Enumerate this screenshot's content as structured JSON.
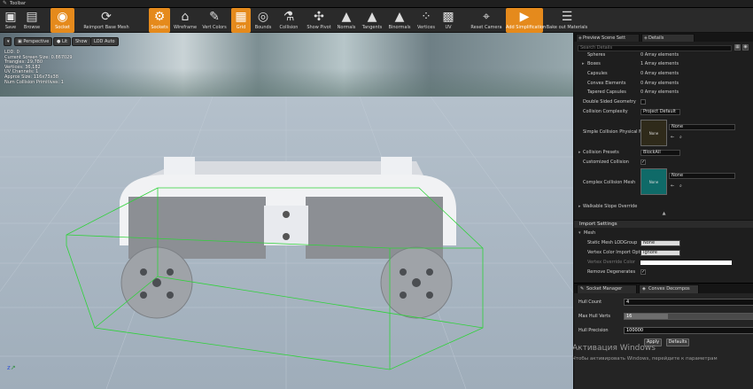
{
  "window": {
    "title": "Toolbar"
  },
  "toolbar": {
    "items": [
      {
        "label": "Save",
        "icon": "save-icon",
        "active": false
      },
      {
        "label": "Browse",
        "icon": "browse-icon",
        "active": false
      },
      {
        "label": "Socket",
        "icon": "socket-icon",
        "active": true
      },
      {
        "label": "Reimport Base Mesh",
        "icon": "reimport-icon",
        "active": false
      },
      {
        "label": "Sockets",
        "icon": "sockets-icon",
        "active": true
      },
      {
        "label": "Wireframe",
        "icon": "wireframe-icon",
        "active": false
      },
      {
        "label": "Vert Colors",
        "icon": "vert-colors-icon",
        "active": false
      },
      {
        "label": "Grid",
        "icon": "grid-icon",
        "active": true
      },
      {
        "label": "Bounds",
        "icon": "bounds-icon",
        "active": false
      },
      {
        "label": "Collision",
        "icon": "collision-icon",
        "active": false
      },
      {
        "label": "Show Pivot",
        "icon": "pivot-icon",
        "active": false
      },
      {
        "label": "Normals",
        "icon": "normals-icon",
        "active": false
      },
      {
        "label": "Tangents",
        "icon": "tangents-icon",
        "active": false
      },
      {
        "label": "Binormals",
        "icon": "binormals-icon",
        "active": false
      },
      {
        "label": "Vertices",
        "icon": "vertices-icon",
        "active": false
      },
      {
        "label": "UV",
        "icon": "uv-icon",
        "active": false
      },
      {
        "label": "Reset Camera",
        "icon": "reset-camera-icon",
        "active": false
      },
      {
        "label": "Add Simplification",
        "icon": "simplify-icon",
        "active": true
      },
      {
        "label": "Bake out Materials",
        "icon": "bake-icon",
        "active": false
      }
    ]
  },
  "viewport": {
    "buttons": {
      "menu": "▾",
      "perspective": "Perspective",
      "lit": "Lit",
      "show": "Show",
      "lod": "LOD Auto"
    },
    "stats": [
      "LOD: 0",
      "Current Screen Size: 0.867029",
      "Triangles: 29,780",
      "Vertices: 36,182",
      "UV Channels: 1",
      "Approx Size: 116x73x38",
      "Num Collision Primitives: 1"
    ]
  },
  "right_panel": {
    "tabs": [
      "Preview Scene Sett",
      "Details"
    ],
    "search_placeholder": "Search Details",
    "properties": [
      {
        "key": "Spheres",
        "value": "0 Array elements"
      },
      {
        "key": "Boxes",
        "value": "1 Array elements"
      },
      {
        "key": "Capsules",
        "value": "0 Array elements"
      },
      {
        "key": "Convex Elements",
        "value": "0 Array elements"
      },
      {
        "key": "Tapered Capsules",
        "value": "0 Array elements"
      }
    ],
    "double_sided": "Double Sided Geometry",
    "collision_complexity": {
      "label": "Collision Complexity",
      "value": "Project Default"
    },
    "simple_physmat": {
      "label": "Simple Collision Physical M",
      "swatch": "None",
      "combo": "None"
    },
    "collision_presets": {
      "label": "Collision Presets",
      "value": "BlockAll"
    },
    "customized_collision": "Customized Collision",
    "complex_mesh": {
      "label": "Complex Collision Mesh",
      "swatch": "None",
      "combo": "None"
    },
    "walkable": "Walkable Slope Override",
    "import_settings": "Import Settings",
    "mesh": "Mesh",
    "lod_group": {
      "label": "Static Mesh LODGroup",
      "value": "None"
    },
    "vertex_color": {
      "label": "Vertex Color Import Optio",
      "value": "Ignore"
    },
    "vertex_override": {
      "label": "Vertex Override Color"
    },
    "remove_degenerates": "Remove Degenerates"
  },
  "bottom_panel": {
    "tabs": [
      "Socket Manager",
      "Convex Decompos"
    ],
    "hull_count": {
      "label": "Hull Count",
      "value": "4"
    },
    "max_hull_verts": {
      "label": "Max Hull Verts",
      "value": "16",
      "fill": 0.34
    },
    "hull_precision": {
      "label": "Hull Precision",
      "value": "100000"
    },
    "apply": "Apply",
    "defaults": "Defaults"
  },
  "watermark": {
    "line1": "Активация Windows",
    "line2": "Чтобы активировать Windows, перейдите к параметрам"
  },
  "colors": {
    "accent": "#e58a1c",
    "wire": "#2fd23a"
  }
}
